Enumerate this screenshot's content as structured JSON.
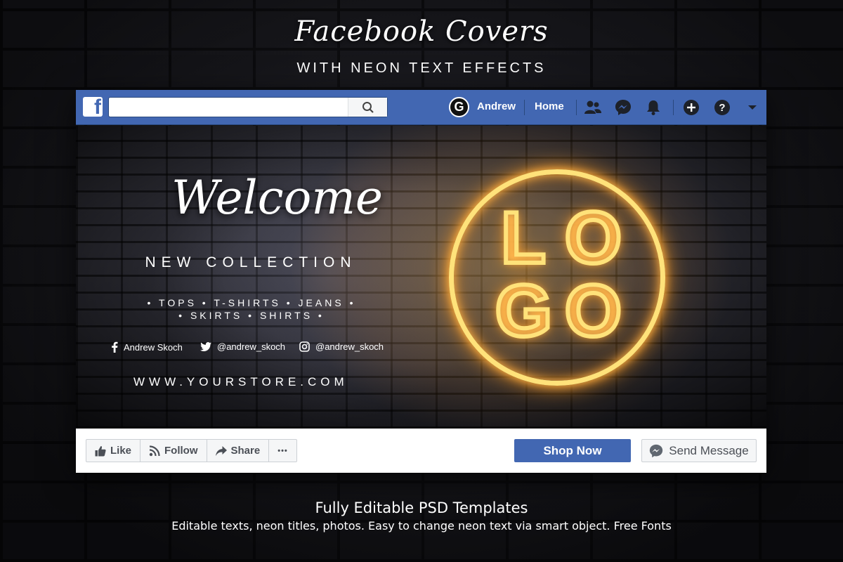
{
  "header": {
    "script_title": "Facebook Covers",
    "subtitle": "WITH NEON TEXT EFFECTS"
  },
  "fb": {
    "logo_letter": "f",
    "search": {
      "value": "",
      "placeholder": ""
    },
    "nav": {
      "avatar_letter": "G",
      "user": "Andrew",
      "home": "Home"
    },
    "cover": {
      "welcome": "Welcome",
      "collection": "NEW COLLECTION",
      "categories_line1": "• TOPS • T-SHIRTS • JEANS •",
      "categories_line2": "• SKIRTS • SHIRTS •",
      "social": {
        "facebook": "Andrew Skoch",
        "twitter": "@andrew_skoch",
        "instagram": "@andrew_skoch"
      },
      "website": "WWW.YOURSTORE.COM",
      "logo_letters": [
        "L",
        "O",
        "G",
        "O"
      ],
      "neon_color": "#ffe27a"
    },
    "actions": {
      "like": "Like",
      "follow": "Follow",
      "share": "Share",
      "more": "•••",
      "shop": "Shop Now",
      "message": "Send Message"
    },
    "colors": {
      "brand_blue": "#4267b2",
      "button_gray": "#f5f6f7"
    }
  },
  "footer": {
    "title": "Fully Editable PSD Templates",
    "subtitle": "Editable texts, neon titles, photos. Easy to change neon text via smart object. Free Fonts"
  }
}
